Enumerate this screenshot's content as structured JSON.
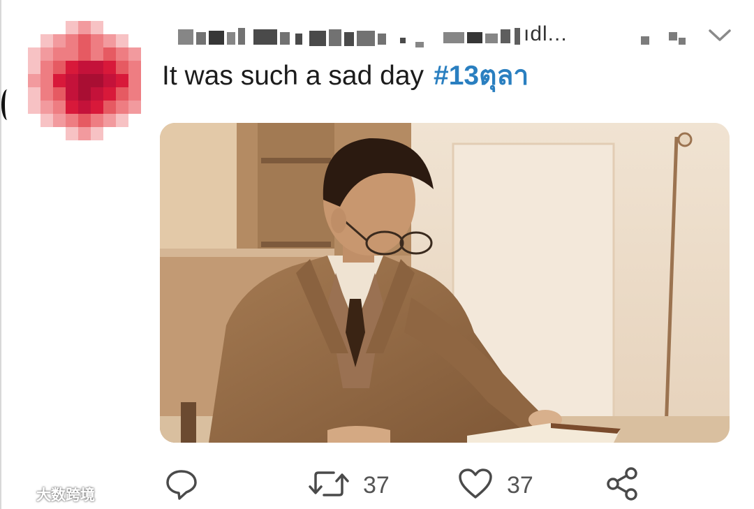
{
  "tweet": {
    "username_visible_fragment": "ıdl...",
    "text": "It was such a sad day",
    "hashtag": "#13ตุลา"
  },
  "media": {
    "description_icon": "photo"
  },
  "actions": {
    "reply_icon": "reply-bubble-icon",
    "retweet_icon": "retweet-icon",
    "retweet_count": "37",
    "like_icon": "heart-icon",
    "like_count": "37",
    "share_icon": "share-icon"
  },
  "watermark": {
    "text": "大数跨境"
  },
  "colors": {
    "hashtag": "#2a7fc0",
    "icon": "#4a4a4a",
    "text": "#1c1c1c",
    "sepia": "#c9a27a"
  }
}
